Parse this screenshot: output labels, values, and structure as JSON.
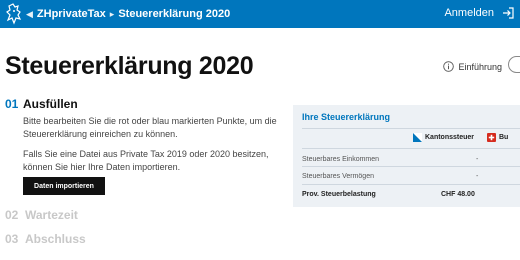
{
  "header": {
    "brand": "ZHprivateTax",
    "breadcrumb": "Steuererklärung 2020",
    "login_label": "Anmelden"
  },
  "page": {
    "title": "Steuererklärung 2020",
    "intro_label": "Einführung"
  },
  "steps": [
    {
      "number": "01",
      "title": "Ausfüllen",
      "paragraph1": "Bitte bearbeiten Sie die rot oder blau markierten Punkte, um die Steuererklärung einreichen zu können.",
      "paragraph2": "Falls Sie eine Datei aus Private Tax 2019 oder 2020 besitzen, können Sie hier Ihre Daten importieren.",
      "button_label": "Daten importieren"
    },
    {
      "number": "02",
      "title": "Wartezeit"
    },
    {
      "number": "03",
      "title": "Abschluss"
    }
  ],
  "summary": {
    "title": "Ihre Steuererklärung",
    "col_kanton": "Kantonssteuer",
    "col_bund": "Bu",
    "rows": [
      {
        "label": "Steuerbares Einkommen",
        "kanton": "-"
      },
      {
        "label": "Steuerbares Vermögen",
        "kanton": "-"
      }
    ],
    "total_label": "Prov. Steuerbelastung",
    "total_value": "CHF 48.00"
  },
  "colors": {
    "accent": "#0076bd",
    "panel_bg": "#edf1f5",
    "muted_step": "#c8c8c8"
  }
}
